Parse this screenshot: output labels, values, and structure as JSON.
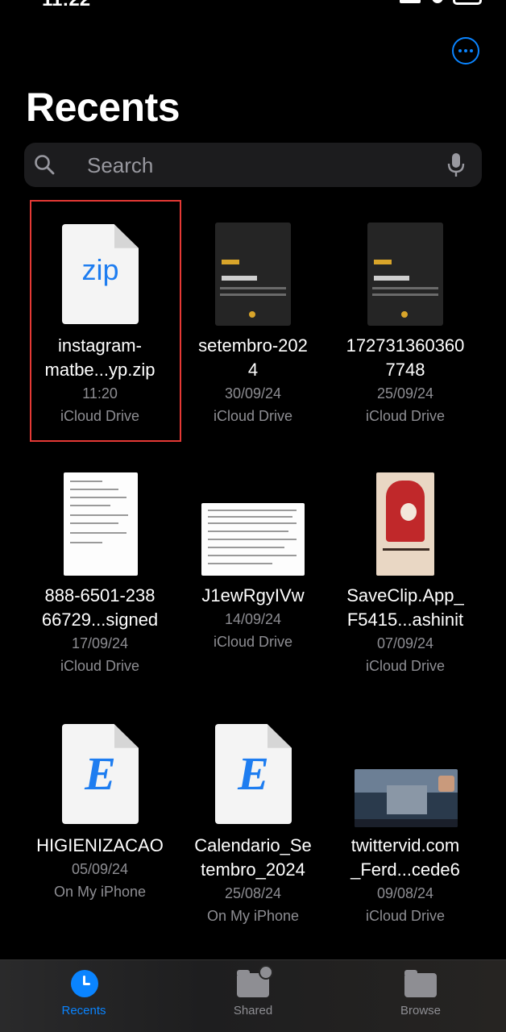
{
  "status_bar": {
    "time": "11:22"
  },
  "header": {
    "more_icon": "ellipsis-circle-icon",
    "title": "Recents"
  },
  "search": {
    "placeholder": "Search",
    "search_icon": "magnifying-glass-icon",
    "mic_icon": "microphone-icon"
  },
  "files": [
    {
      "name_line1": "instagram-",
      "name_line2": "matbe...yp.zip",
      "date": "11:20",
      "location": "iCloud Drive",
      "icon": "zip-file-icon",
      "icon_text": "zip",
      "selected": true
    },
    {
      "name_line1": "setembro-202",
      "name_line2": "4",
      "date": "30/09/24",
      "location": "iCloud Drive",
      "icon": "pdf-thumbnail"
    },
    {
      "name_line1": "172731360360",
      "name_line2": "7748",
      "date": "25/09/24",
      "location": "iCloud Drive",
      "icon": "pdf-thumbnail"
    },
    {
      "name_line1": "888-6501-238",
      "name_line2": "66729...signed",
      "date": "17/09/24",
      "location": "iCloud Drive",
      "icon": "document-thumbnail"
    },
    {
      "name_line1": "J1ewRgyIVw",
      "name_line2": "",
      "date": "14/09/24",
      "location": "iCloud Drive",
      "icon": "document-thumbnail"
    },
    {
      "name_line1": "SaveClip.App_",
      "name_line2": "F5415...ashinit",
      "date": "07/09/24",
      "location": "iCloud Drive",
      "icon": "image-thumbnail"
    },
    {
      "name_line1": "HIGIENIZACAO",
      "name_line2": "",
      "date": "05/09/24",
      "location": "On My iPhone",
      "icon": "epub-file-icon",
      "icon_text": "E"
    },
    {
      "name_line1": "Calendario_Se",
      "name_line2": "tembro_2024",
      "date": "25/08/24",
      "location": "On My iPhone",
      "icon": "epub-file-icon",
      "icon_text": "E"
    },
    {
      "name_line1": "twittervid.com",
      "name_line2": "_Ferd...cede6",
      "date": "09/08/24",
      "location": "iCloud Drive",
      "icon": "video-thumbnail"
    }
  ],
  "tabbar": {
    "recents": {
      "label": "Recents",
      "icon": "clock-icon",
      "active": true
    },
    "shared": {
      "label": "Shared",
      "icon": "shared-folder-icon"
    },
    "browse": {
      "label": "Browse",
      "icon": "folder-icon"
    }
  },
  "colors": {
    "accent": "#0a84ff",
    "background": "#000000",
    "secondary_text": "#8e8e93",
    "selection_border": "#e53935"
  }
}
